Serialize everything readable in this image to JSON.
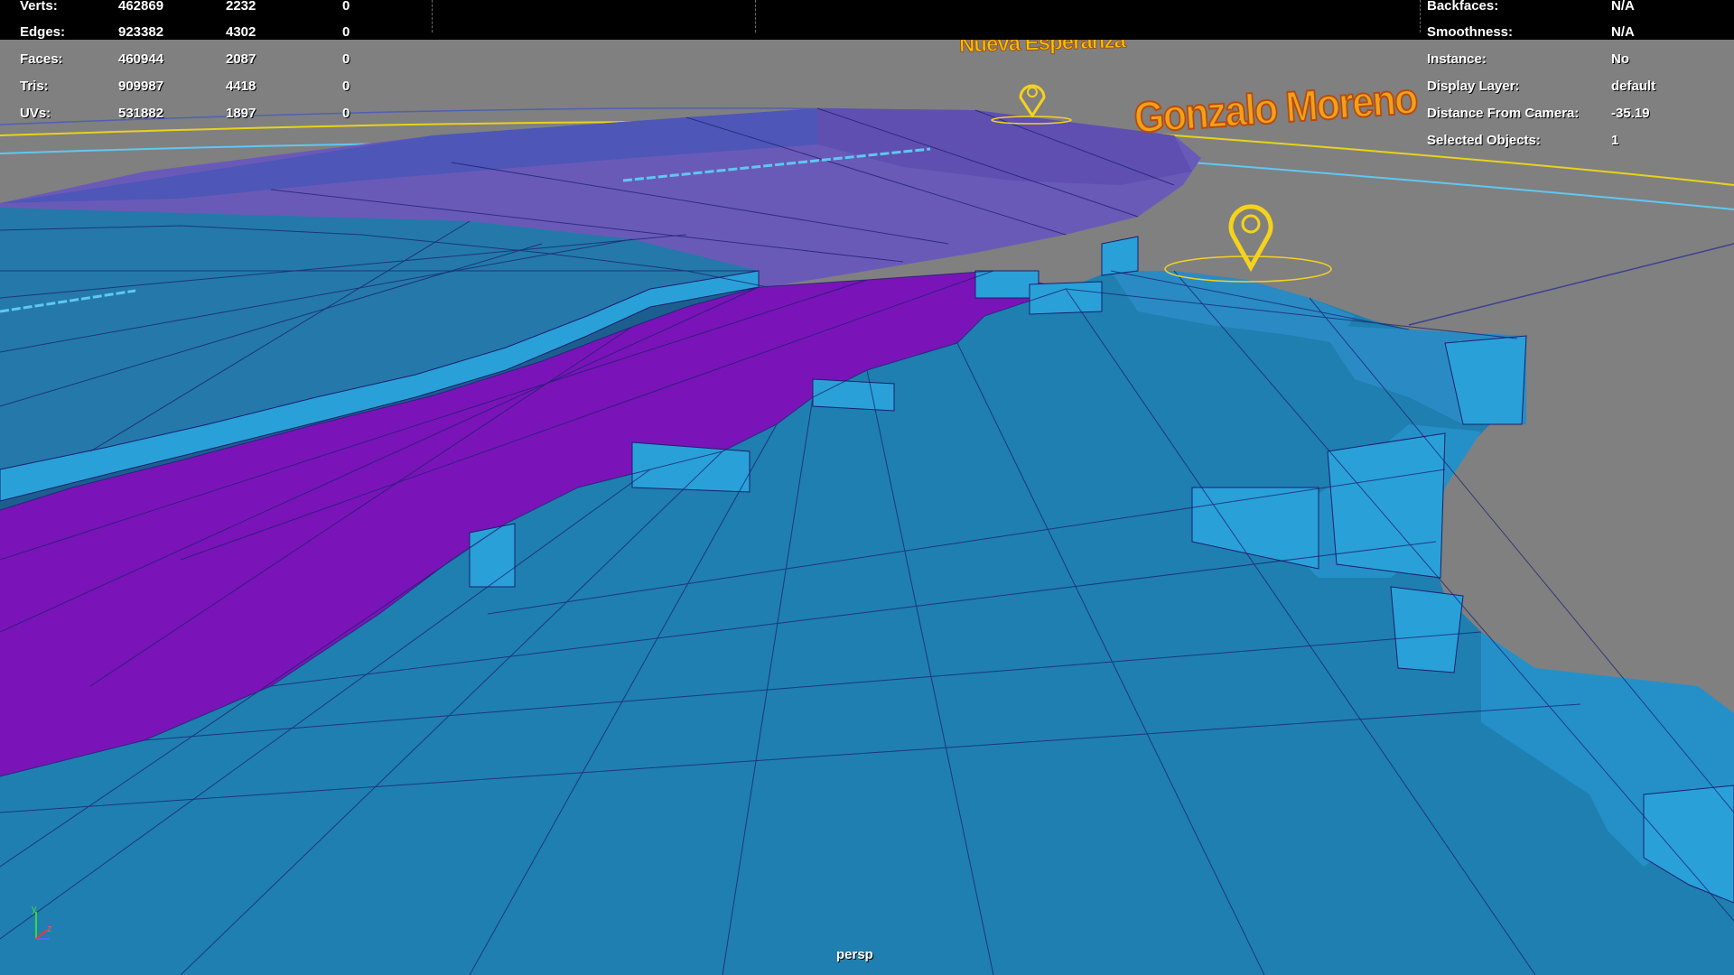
{
  "poly_stats": {
    "rows": [
      {
        "label": "Verts:",
        "v1": "462869",
        "v2": "2232",
        "v3": "0"
      },
      {
        "label": "Edges:",
        "v1": "923382",
        "v2": "4302",
        "v3": "0"
      },
      {
        "label": "Faces:",
        "v1": "460944",
        "v2": "2087",
        "v3": "0"
      },
      {
        "label": "Tris:",
        "v1": "909987",
        "v2": "4418",
        "v3": "0"
      },
      {
        "label": "UVs:",
        "v1": "531882",
        "v2": "1897",
        "v3": "0"
      }
    ]
  },
  "object_info": {
    "rows": [
      {
        "label": "Backfaces:",
        "value": "N/A"
      },
      {
        "label": "Smoothness:",
        "value": "N/A"
      },
      {
        "label": "Instance:",
        "value": "No"
      },
      {
        "label": "Display Layer:",
        "value": "default"
      },
      {
        "label": "Distance From Camera:",
        "value": "-35.19"
      },
      {
        "label": "Selected Objects:",
        "value": "1"
      }
    ]
  },
  "viewport": {
    "camera_label": "persp",
    "background_color": "#808080",
    "axis_labels": {
      "y": "y",
      "z": "z"
    }
  },
  "scene": {
    "location_labels": [
      {
        "text": "Nueva Esperanza"
      },
      {
        "text": "Gonzalo Moreno"
      }
    ],
    "colors": {
      "mesh_blue": "#1f7fb0",
      "mesh_magenta": "#7a14b8",
      "mesh_violet": "#6a5ab8",
      "wireframe": "#1a1f6e",
      "marker_yellow": "#f5d21c",
      "curve_yellow": "#e8d21a",
      "curve_cyan": "#5fc8f0"
    },
    "icons": [
      "map-pin-icon",
      "map-pin-icon",
      "axis-gizmo-icon"
    ]
  }
}
